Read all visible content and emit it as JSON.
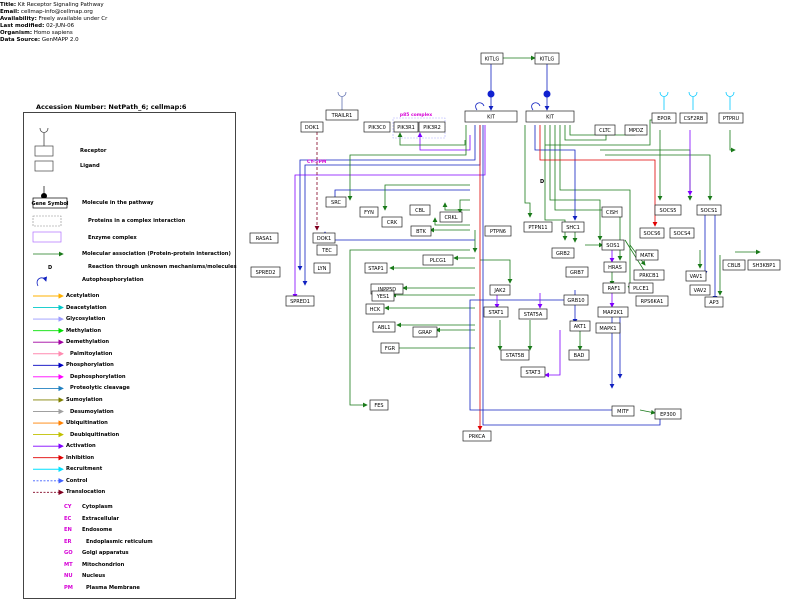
{
  "header": {
    "title_label": "Title:",
    "title": "Kit Receptor Signaling Pathway",
    "email_label": "Email:",
    "email": "cellmap-info@cellmap.org",
    "availability_label": "Availability:",
    "availability": "Freely available under Cr",
    "modified_label": "Last modified:",
    "modified": "02-JUN-06",
    "organism_label": "Organism:",
    "organism": "Homo sapiens",
    "source_label": "Data Source:",
    "source": "GenMAPP 2.0"
  },
  "accession": "Accession Number: NetPath_6; cellmap:6",
  "legend": {
    "items": [
      {
        "label": "Receptor"
      },
      {
        "label": "Ligand"
      },
      {
        "label": "Molecule in the pathway",
        "box": "Gene Symbol"
      },
      {
        "label": "Proteins in a complex interaction"
      },
      {
        "label": "Enzyme complex"
      },
      {
        "label": "Molecular association     (Protein-protein interaction)"
      },
      {
        "label": "Reaction through unknown mechanisms/molecules",
        "mark": "D"
      },
      {
        "label": "Autophosphorylation"
      }
    ],
    "arrows": [
      {
        "label": "Acetylation",
        "color": "#ffb000"
      },
      {
        "label": "Deacetylation",
        "color": "#00c8c8"
      },
      {
        "label": "Glycosylation",
        "color": "#9a9aff"
      },
      {
        "label": "Methylation",
        "color": "#00e000"
      },
      {
        "label": "Demethylation",
        "color": "#a000a0"
      },
      {
        "label": "Palmitoylation",
        "color": "#ff8ab0"
      },
      {
        "label": "Phosphorylation",
        "color": "#0000c0"
      },
      {
        "label": "Dephosphorylation",
        "color": "#ff00ff"
      },
      {
        "label": "Proteolytic cleavage",
        "color": "#2080c0"
      },
      {
        "label": "Sumoylation",
        "color": "#808000"
      },
      {
        "label": "Desumoylation",
        "color": "#a0a0a0"
      },
      {
        "label": "Ubiquitination",
        "color": "#ff8000"
      },
      {
        "label": "Deubiquitination",
        "color": "#c0c000"
      },
      {
        "label": "Activation",
        "color": "#8000ff"
      },
      {
        "label": "Inhibition",
        "color": "#e00000"
      },
      {
        "label": "Recruitment",
        "color": "#00e0ff"
      },
      {
        "label": "Control",
        "color": "#4060ff"
      },
      {
        "label": "Translocation",
        "color": "#800020"
      }
    ],
    "locations": [
      {
        "code": "CY",
        "label": "Cytoplasm"
      },
      {
        "code": "EC",
        "label": "Extracellular"
      },
      {
        "code": "EN",
        "label": "Endosome"
      },
      {
        "code": "ER",
        "label": "Endoplasmic reticulum"
      },
      {
        "code": "GO",
        "label": "Golgi apparatus"
      },
      {
        "code": "MT",
        "label": "Mitochondrion"
      },
      {
        "code": "NU",
        "label": "Nucleus"
      },
      {
        "code": "PM",
        "label": "Plasma Membrane"
      }
    ]
  },
  "diagram": {
    "complex_label": "p85 complex",
    "translocation_label": "CY->PM",
    "unknown_mark": "D",
    "nodes": [
      {
        "id": "KITLG_1",
        "label": "KITLG"
      },
      {
        "id": "KITLG_2",
        "label": "KITLG"
      },
      {
        "id": "KIT_1",
        "label": "KIT"
      },
      {
        "id": "KIT_2",
        "label": "KIT"
      },
      {
        "id": "TRAILR1",
        "label": "TRAILR1"
      },
      {
        "id": "DOK1a",
        "label": "DOK1"
      },
      {
        "id": "PIK3C0",
        "label": "PIK3C0"
      },
      {
        "id": "PIK3R1",
        "label": "PIK3R1"
      },
      {
        "id": "PIK3R2",
        "label": "PIK3R2"
      },
      {
        "id": "CLTC",
        "label": "CLTC"
      },
      {
        "id": "MPDZ",
        "label": "MPDZ"
      },
      {
        "id": "EPOR",
        "label": "EPOR"
      },
      {
        "id": "CSF2RB",
        "label": "CSF2RB"
      },
      {
        "id": "PTPRU",
        "label": "PTPRU"
      },
      {
        "id": "SRC",
        "label": "SRC"
      },
      {
        "id": "FYN",
        "label": "FYN"
      },
      {
        "id": "CBL",
        "label": "CBL"
      },
      {
        "id": "CRKL",
        "label": "CRKL"
      },
      {
        "id": "CRK",
        "label": "CRK"
      },
      {
        "id": "BTK",
        "label": "BTK"
      },
      {
        "id": "PTPN6",
        "label": "PTPN6"
      },
      {
        "id": "PTPN11",
        "label": "PTPN11"
      },
      {
        "id": "SHC1",
        "label": "SHC1"
      },
      {
        "id": "CISH",
        "label": "CISH"
      },
      {
        "id": "SOCS5",
        "label": "SOCS5"
      },
      {
        "id": "SOCS1",
        "label": "SOCS1"
      },
      {
        "id": "SOCS6",
        "label": "SOCS6"
      },
      {
        "id": "SOCS4",
        "label": "SOCS4"
      },
      {
        "id": "MATK",
        "label": "MATK"
      },
      {
        "id": "RASA1",
        "label": "RASA1"
      },
      {
        "id": "DOK1",
        "label": "DOK1"
      },
      {
        "id": "TEC",
        "label": "TEC"
      },
      {
        "id": "LYN",
        "label": "LYN"
      },
      {
        "id": "SPRED2",
        "label": "SPRED2"
      },
      {
        "id": "SPRED1",
        "label": "SPRED1"
      },
      {
        "id": "STAP1",
        "label": "STAP1"
      },
      {
        "id": "PLCG1",
        "label": "PLCG1"
      },
      {
        "id": "GRB2",
        "label": "GRB2"
      },
      {
        "id": "SOS1",
        "label": "SOS1"
      },
      {
        "id": "HRAS",
        "label": "HRAS"
      },
      {
        "id": "GRB7",
        "label": "GRB7"
      },
      {
        "id": "PRKCB1",
        "label": "PRKCB1"
      },
      {
        "id": "RAF1",
        "label": "RAF1"
      },
      {
        "id": "PLCE1",
        "label": "PLCE1"
      },
      {
        "id": "RPS6KA1",
        "label": "RPS6KA1"
      },
      {
        "id": "MAP2K1",
        "label": "MAP2K1"
      },
      {
        "id": "MAPK1",
        "label": "MAPK1"
      },
      {
        "id": "GRB10",
        "label": "GRB10"
      },
      {
        "id": "AKT1",
        "label": "AKT1"
      },
      {
        "id": "BAD",
        "label": "BAD"
      },
      {
        "id": "INPP5D",
        "label": "INPP5D"
      },
      {
        "id": "YES1",
        "label": "YES1"
      },
      {
        "id": "HCK",
        "label": "HCK"
      },
      {
        "id": "ABL1",
        "label": "ABL1"
      },
      {
        "id": "FGR",
        "label": "FGR"
      },
      {
        "id": "FES",
        "label": "FES"
      },
      {
        "id": "GRAP",
        "label": "GRAP"
      },
      {
        "id": "JAK2",
        "label": "JAK2"
      },
      {
        "id": "STAT1",
        "label": "STAT1"
      },
      {
        "id": "STAT5A",
        "label": "STAT5A"
      },
      {
        "id": "STAT5B",
        "label": "STAT5B"
      },
      {
        "id": "STAT3",
        "label": "STAT3"
      },
      {
        "id": "MITF",
        "label": "MITF"
      },
      {
        "id": "EP300",
        "label": "EP300"
      },
      {
        "id": "PRKCA",
        "label": "PRKCA"
      },
      {
        "id": "VAV1",
        "label": "VAV1"
      },
      {
        "id": "VAV2",
        "label": "VAV2"
      },
      {
        "id": "AP3",
        "label": "AP3"
      },
      {
        "id": "CBLB",
        "label": "CBLB"
      },
      {
        "id": "SH3KBP1",
        "label": "SH3KBP1"
      }
    ]
  }
}
